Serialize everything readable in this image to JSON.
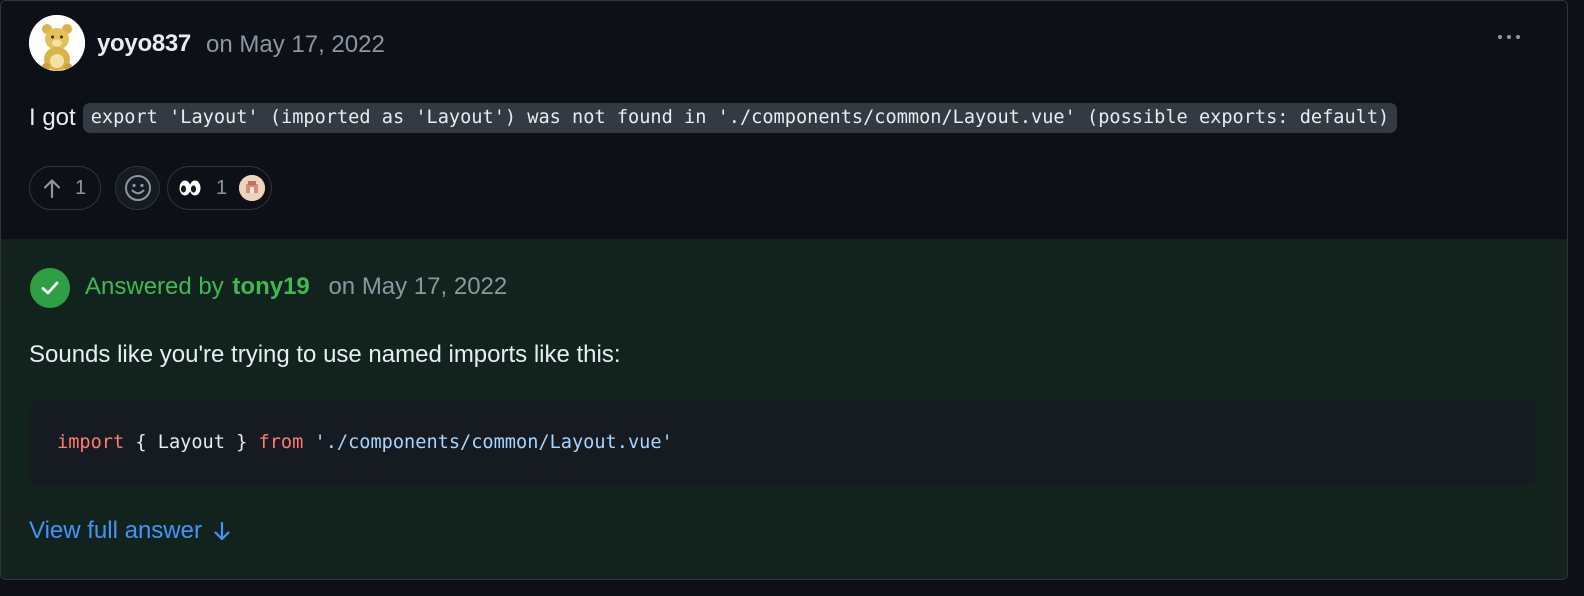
{
  "post": {
    "author": "yoyo837",
    "date": "on May 17, 2022",
    "text_prefix": "I got",
    "code": "export 'Layout' (imported as 'Layout') was not found in './components/common/Layout.vue' (possible exports: default)",
    "upvote_count": "1",
    "reaction": {
      "emoji": "eyes",
      "count": "1"
    }
  },
  "answer": {
    "answered_by_label": "Answered by",
    "answerer": "tony19",
    "date": "on May 17, 2022",
    "text": "Sounds like you're trying to use named imports like this:",
    "code": {
      "keyword_import": "import",
      "braces": " { Layout } ",
      "keyword_from": "from",
      "space": " ",
      "path": "'./components/common/Layout.vue'"
    },
    "view_full_label": "View full answer"
  },
  "colors": {
    "accent_green": "#3fb950",
    "link_blue": "#4493f8",
    "answer_bg": "#12231e",
    "code_keyword": "#ff7b72",
    "code_string": "#a5d6ff"
  }
}
